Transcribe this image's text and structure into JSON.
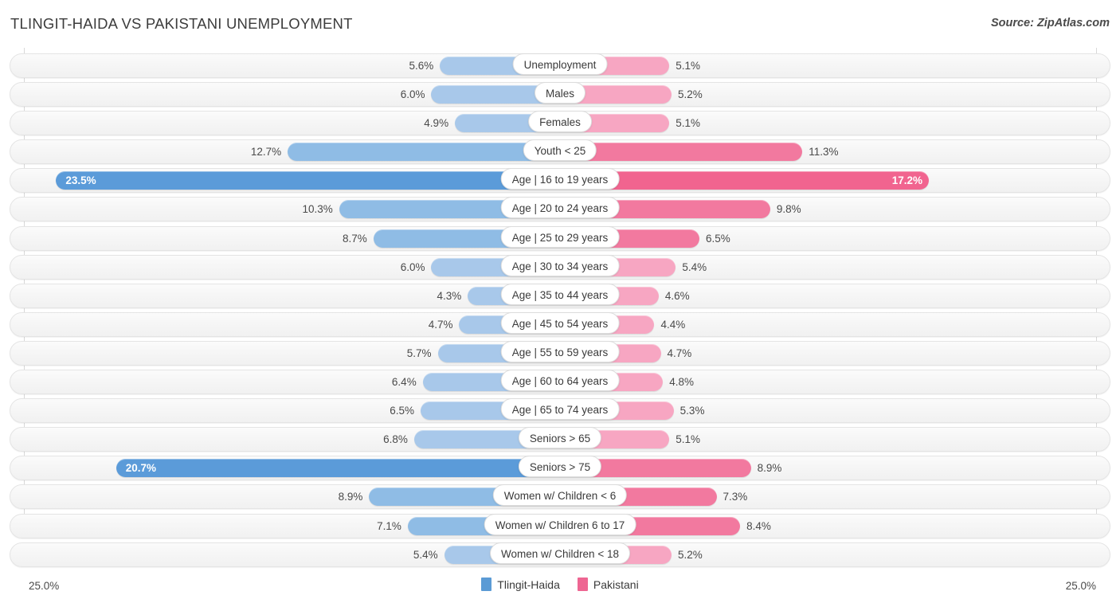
{
  "header": {
    "title": "TLINGIT-HAIDA VS PAKISTANI UNEMPLOYMENT",
    "source": "Source: ZipAtlas.com"
  },
  "legend": {
    "items": [
      {
        "label": "Tlingit-Haida",
        "color": "#5b9bd5"
      },
      {
        "label": "Pakistani",
        "color": "#ee6692"
      }
    ]
  },
  "axis": {
    "left_label": "25.0%",
    "right_label": "25.0%",
    "max": 25.0
  },
  "colors": {
    "blue_normal": "#a8c8ea",
    "blue_highlight": "#5b9bd9",
    "pink_normal": "#f7a6c2",
    "pink_highlight": "#f1648f",
    "pink_mid": "#f2799f",
    "track": "#f5f5f5",
    "grid": "#d8d8d8"
  },
  "chart_data": {
    "type": "bar",
    "title": "TLINGIT-HAIDA VS PAKISTANI UNEMPLOYMENT",
    "subtitle": "",
    "xlabel": "",
    "ylabel": "",
    "orientation": "horizontal-diverging",
    "xlim": [
      25.0,
      25.0
    ],
    "grid": true,
    "legend_position": "bottom-center",
    "categories": [
      "Unemployment",
      "Males",
      "Females",
      "Youth < 25",
      "Age | 16 to 19 years",
      "Age | 20 to 24 years",
      "Age | 25 to 29 years",
      "Age | 30 to 34 years",
      "Age | 35 to 44 years",
      "Age | 45 to 54 years",
      "Age | 55 to 59 years",
      "Age | 60 to 64 years",
      "Age | 65 to 74 years",
      "Seniors > 65",
      "Seniors > 75",
      "Women w/ Children < 6",
      "Women w/ Children 6 to 17",
      "Women w/ Children < 18"
    ],
    "series": [
      {
        "name": "Tlingit-Haida",
        "color": "#5b9bd5",
        "values": [
          5.6,
          6.0,
          4.9,
          12.7,
          23.5,
          10.3,
          8.7,
          6.0,
          4.3,
          4.7,
          5.7,
          6.4,
          6.5,
          6.8,
          20.7,
          8.9,
          7.1,
          5.4
        ],
        "labels": [
          "5.6%",
          "6.0%",
          "4.9%",
          "12.7%",
          "23.5%",
          "10.3%",
          "8.7%",
          "6.0%",
          "4.3%",
          "4.7%",
          "5.7%",
          "6.4%",
          "6.5%",
          "6.8%",
          "20.7%",
          "8.9%",
          "7.1%",
          "5.4%"
        ]
      },
      {
        "name": "Pakistani",
        "color": "#ee6692",
        "values": [
          5.1,
          5.2,
          5.1,
          11.3,
          17.2,
          9.8,
          6.5,
          5.4,
          4.6,
          4.4,
          4.7,
          4.8,
          5.3,
          5.1,
          8.9,
          7.3,
          8.4,
          5.2
        ],
        "labels": [
          "5.1%",
          "5.2%",
          "5.1%",
          "11.3%",
          "17.2%",
          "9.8%",
          "6.5%",
          "5.4%",
          "4.6%",
          "4.4%",
          "4.7%",
          "4.8%",
          "5.3%",
          "5.1%",
          "8.9%",
          "7.3%",
          "8.4%",
          "5.2%"
        ]
      }
    ]
  },
  "rows": [
    {
      "label": "Unemployment",
      "left_value": 5.6,
      "left_label": "5.6%",
      "right_value": 5.1,
      "right_label": "5.1%",
      "left_style": "normal",
      "right_style": "normal"
    },
    {
      "label": "Males",
      "left_value": 6.0,
      "left_label": "6.0%",
      "right_value": 5.2,
      "right_label": "5.2%",
      "left_style": "normal",
      "right_style": "normal"
    },
    {
      "label": "Females",
      "left_value": 4.9,
      "left_label": "4.9%",
      "right_value": 5.1,
      "right_label": "5.1%",
      "left_style": "normal",
      "right_style": "normal"
    },
    {
      "label": "Youth < 25",
      "left_value": 12.7,
      "left_label": "12.7%",
      "right_value": 11.3,
      "right_label": "11.3%",
      "left_style": "mid",
      "right_style": "mid"
    },
    {
      "label": "Age | 16 to 19 years",
      "left_value": 23.5,
      "left_label": "23.5%",
      "right_value": 17.2,
      "right_label": "17.2%",
      "left_style": "highlight",
      "right_style": "highlight"
    },
    {
      "label": "Age | 20 to 24 years",
      "left_value": 10.3,
      "left_label": "10.3%",
      "right_value": 9.8,
      "right_label": "9.8%",
      "left_style": "mid",
      "right_style": "mid"
    },
    {
      "label": "Age | 25 to 29 years",
      "left_value": 8.7,
      "left_label": "8.7%",
      "right_value": 6.5,
      "right_label": "6.5%",
      "left_style": "mid",
      "right_style": "mid"
    },
    {
      "label": "Age | 30 to 34 years",
      "left_value": 6.0,
      "left_label": "6.0%",
      "right_value": 5.4,
      "right_label": "5.4%",
      "left_style": "normal",
      "right_style": "normal"
    },
    {
      "label": "Age | 35 to 44 years",
      "left_value": 4.3,
      "left_label": "4.3%",
      "right_value": 4.6,
      "right_label": "4.6%",
      "left_style": "normal",
      "right_style": "normal"
    },
    {
      "label": "Age | 45 to 54 years",
      "left_value": 4.7,
      "left_label": "4.7%",
      "right_value": 4.4,
      "right_label": "4.4%",
      "left_style": "normal",
      "right_style": "normal"
    },
    {
      "label": "Age | 55 to 59 years",
      "left_value": 5.7,
      "left_label": "5.7%",
      "right_value": 4.7,
      "right_label": "4.7%",
      "left_style": "normal",
      "right_style": "normal"
    },
    {
      "label": "Age | 60 to 64 years",
      "left_value": 6.4,
      "left_label": "6.4%",
      "right_value": 4.8,
      "right_label": "4.8%",
      "left_style": "normal",
      "right_style": "normal"
    },
    {
      "label": "Age | 65 to 74 years",
      "left_value": 6.5,
      "left_label": "6.5%",
      "right_value": 5.3,
      "right_label": "5.3%",
      "left_style": "normal",
      "right_style": "normal"
    },
    {
      "label": "Seniors > 65",
      "left_value": 6.8,
      "left_label": "6.8%",
      "right_value": 5.1,
      "right_label": "5.1%",
      "left_style": "normal",
      "right_style": "normal"
    },
    {
      "label": "Seniors > 75",
      "left_value": 20.7,
      "left_label": "20.7%",
      "right_value": 8.9,
      "right_label": "8.9%",
      "left_style": "highlight",
      "right_style": "mid"
    },
    {
      "label": "Women w/ Children < 6",
      "left_value": 8.9,
      "left_label": "8.9%",
      "right_value": 7.3,
      "right_label": "7.3%",
      "left_style": "mid",
      "right_style": "mid"
    },
    {
      "label": "Women w/ Children 6 to 17",
      "left_value": 7.1,
      "left_label": "7.1%",
      "right_value": 8.4,
      "right_label": "8.4%",
      "left_style": "mid",
      "right_style": "mid"
    },
    {
      "label": "Women w/ Children < 18",
      "left_value": 5.4,
      "left_label": "5.4%",
      "right_value": 5.2,
      "right_label": "5.2%",
      "left_style": "normal",
      "right_style": "normal"
    }
  ]
}
